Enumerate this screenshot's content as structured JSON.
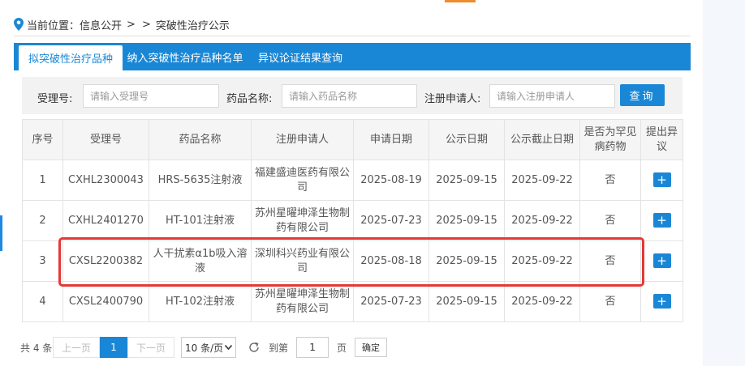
{
  "colors": {
    "accent": "#1a87d6",
    "highlight": "#e53935",
    "orange": "#f08c2a"
  },
  "breadcrumb": {
    "prefix": "当前位置：",
    "item1": "信息公开",
    "sep1": ">",
    "sep2": ">",
    "item2": "突破性治疗公示"
  },
  "tabs": [
    "拟突破性治疗品种",
    "纳入突破性治疗品种名单",
    "异议论证结果查询"
  ],
  "search": {
    "accept_label": "受理号:",
    "accept_placeholder": "请输入受理号",
    "drug_label": "药品名称:",
    "drug_placeholder": "请输入药品名称",
    "applicant_label": "注册申请人:",
    "applicant_placeholder": "请输入注册申请人",
    "query_button": "查询"
  },
  "table": {
    "headers": [
      "序号",
      "受理号",
      "药品名称",
      "注册申请人",
      "申请日期",
      "公示日期",
      "公示截止日期",
      "是否为罕见病药物",
      "提出异议"
    ],
    "rows": [
      {
        "no": "1",
        "accept": "CXHL2300043",
        "drug": "HRS-5635注射液",
        "applicant": "福建盛迪医药有限公司",
        "apply": "2025-08-19",
        "publish": "2025-09-15",
        "deadline": "2025-09-22",
        "rare": "否",
        "object": "+"
      },
      {
        "no": "2",
        "accept": "CXHL2401270",
        "drug": "HT-101注射液",
        "applicant": "苏州星曜坤泽生物制药有限公司",
        "apply": "2025-07-23",
        "publish": "2025-09-15",
        "deadline": "2025-09-22",
        "rare": "否",
        "object": "+"
      },
      {
        "no": "3",
        "accept": "CXSL2200382",
        "drug": "人干扰素α1b吸入溶液",
        "applicant": "深圳科兴药业有限公司",
        "apply": "2025-08-18",
        "publish": "2025-09-15",
        "deadline": "2025-09-22",
        "rare": "否",
        "object": "+"
      },
      {
        "no": "4",
        "accept": "CXSL2400790",
        "drug": "HT-102注射液",
        "applicant": "苏州星曜坤泽生物制药有限公司",
        "apply": "2025-07-23",
        "publish": "2025-09-15",
        "deadline": "2025-09-22",
        "rare": "否",
        "object": "+"
      }
    ]
  },
  "pager": {
    "total": "共 4 条",
    "prev": "上一页",
    "current": "1",
    "next": "下一页",
    "size": "10 条/页",
    "goto": "到第",
    "page_value": "1",
    "page": "页",
    "ok": "确定"
  }
}
